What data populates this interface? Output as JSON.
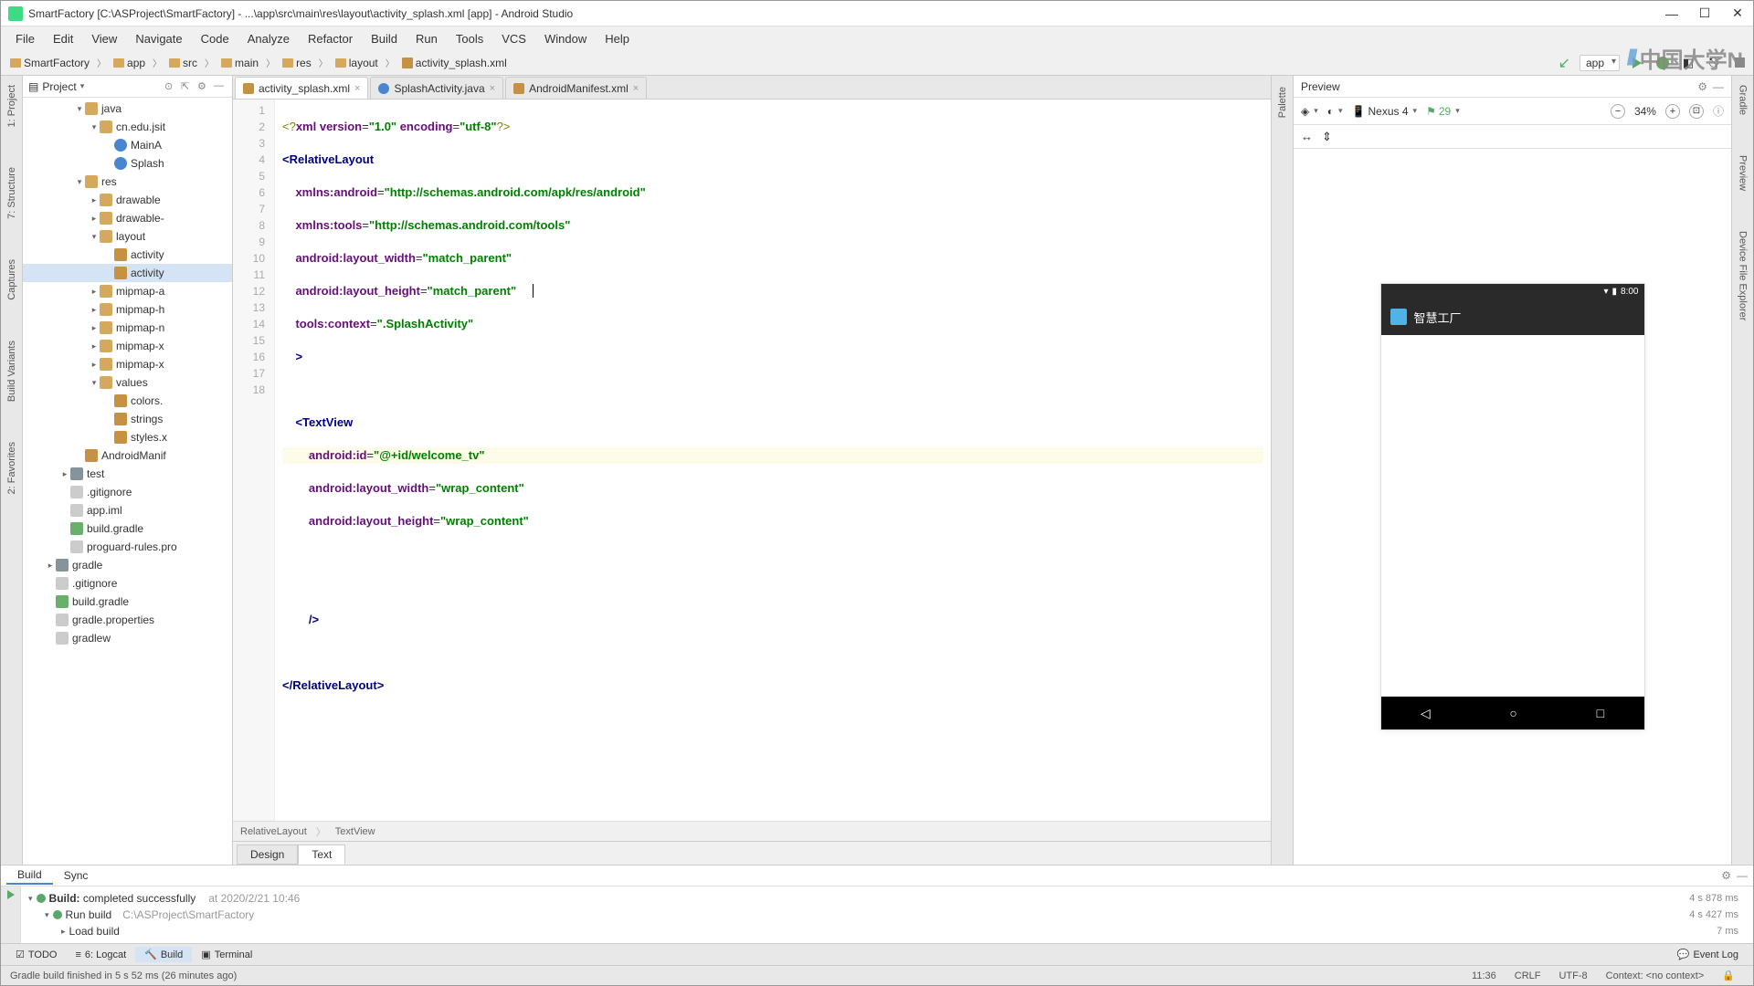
{
  "window": {
    "title": "SmartFactory [C:\\ASProject\\SmartFactory] - ...\\app\\src\\main\\res\\layout\\activity_splash.xml [app] - Android Studio"
  },
  "menu": [
    "File",
    "Edit",
    "View",
    "Navigate",
    "Code",
    "Analyze",
    "Refactor",
    "Build",
    "Run",
    "Tools",
    "VCS",
    "Window",
    "Help"
  ],
  "breadcrumb": [
    "SmartFactory",
    "app",
    "src",
    "main",
    "res",
    "layout",
    "activity_splash.xml"
  ],
  "run_config": "app",
  "watermark": "中国大学N",
  "project": {
    "header": "Project",
    "tree": [
      {
        "depth": 3,
        "exp": "▾",
        "icon": "pkg",
        "label": "java"
      },
      {
        "depth": 4,
        "exp": "▾",
        "icon": "pkg",
        "label": "cn.edu.jsit"
      },
      {
        "depth": 5,
        "exp": "",
        "icon": "java",
        "label": "MainA"
      },
      {
        "depth": 5,
        "exp": "",
        "icon": "java",
        "label": "Splash"
      },
      {
        "depth": 3,
        "exp": "▾",
        "icon": "pkg",
        "label": "res"
      },
      {
        "depth": 4,
        "exp": "▸",
        "icon": "pkg",
        "label": "drawable"
      },
      {
        "depth": 4,
        "exp": "▸",
        "icon": "pkg",
        "label": "drawable-"
      },
      {
        "depth": 4,
        "exp": "▾",
        "icon": "pkg",
        "label": "layout"
      },
      {
        "depth": 5,
        "exp": "",
        "icon": "xml",
        "label": "activity"
      },
      {
        "depth": 5,
        "exp": "",
        "icon": "xml",
        "label": "activity",
        "selected": true
      },
      {
        "depth": 4,
        "exp": "▸",
        "icon": "pkg",
        "label": "mipmap-a"
      },
      {
        "depth": 4,
        "exp": "▸",
        "icon": "pkg",
        "label": "mipmap-h"
      },
      {
        "depth": 4,
        "exp": "▸",
        "icon": "pkg",
        "label": "mipmap-n"
      },
      {
        "depth": 4,
        "exp": "▸",
        "icon": "pkg",
        "label": "mipmap-x"
      },
      {
        "depth": 4,
        "exp": "▸",
        "icon": "pkg",
        "label": "mipmap-x"
      },
      {
        "depth": 4,
        "exp": "▾",
        "icon": "pkg",
        "label": "values"
      },
      {
        "depth": 5,
        "exp": "",
        "icon": "xml",
        "label": "colors."
      },
      {
        "depth": 5,
        "exp": "",
        "icon": "xml",
        "label": "strings"
      },
      {
        "depth": 5,
        "exp": "",
        "icon": "xml",
        "label": "styles.x"
      },
      {
        "depth": 3,
        "exp": "",
        "icon": "xml",
        "label": "AndroidManif"
      },
      {
        "depth": 2,
        "exp": "▸",
        "icon": "folder",
        "label": "test"
      },
      {
        "depth": 2,
        "exp": "",
        "icon": "file",
        "label": ".gitignore"
      },
      {
        "depth": 2,
        "exp": "",
        "icon": "file",
        "label": "app.iml"
      },
      {
        "depth": 2,
        "exp": "",
        "icon": "gradle",
        "label": "build.gradle"
      },
      {
        "depth": 2,
        "exp": "",
        "icon": "file",
        "label": "proguard-rules.pro"
      },
      {
        "depth": 1,
        "exp": "▸",
        "icon": "folder",
        "label": "gradle"
      },
      {
        "depth": 1,
        "exp": "",
        "icon": "file",
        "label": ".gitignore"
      },
      {
        "depth": 1,
        "exp": "",
        "icon": "gradle",
        "label": "build.gradle"
      },
      {
        "depth": 1,
        "exp": "",
        "icon": "file",
        "label": "gradle.properties"
      },
      {
        "depth": 1,
        "exp": "",
        "icon": "file",
        "label": "gradlew"
      }
    ]
  },
  "editor": {
    "tabs": [
      {
        "icon": "xml",
        "label": "activity_splash.xml",
        "active": true
      },
      {
        "icon": "java",
        "label": "SplashActivity.java"
      },
      {
        "icon": "xml",
        "label": "AndroidManifest.xml"
      }
    ],
    "breadcrumb": [
      "RelativeLayout",
      "TextView"
    ],
    "design_text_tabs": [
      "Design",
      "Text"
    ],
    "active_dt_tab": "Text",
    "line_count": 18
  },
  "xml": {
    "l1_a": "<?",
    "l1_b": "xml version",
    "l1_c": "=",
    "l1_d": "\"1.0\"",
    "l1_e": " encoding",
    "l1_f": "=",
    "l1_g": "\"utf-8\"",
    "l1_h": "?>",
    "l2_a": "<",
    "l2_b": "RelativeLayout",
    "l3_a": "xmlns:android",
    "l3_b": "=",
    "l3_c": "\"http://schemas.android.com/apk/res/android\"",
    "l4_a": "xmlns:tools",
    "l4_b": "=",
    "l4_c": "\"http://schemas.android.com/tools\"",
    "l5_a": "android:layout_width",
    "l5_b": "=",
    "l5_c": "\"match_parent\"",
    "l6_a": "android:layout_height",
    "l6_b": "=",
    "l6_c": "\"match_parent\"",
    "l7_a": "tools:context",
    "l7_b": "=",
    "l7_c": "\".SplashActivity\"",
    "l8_a": ">",
    "l10_a": "<",
    "l10_b": "TextView",
    "l11_a": "android:id",
    "l11_b": "=",
    "l11_c": "\"@+id/welcome_tv\"",
    "l12_a": "android:layout_width",
    "l12_b": "=",
    "l12_c": "\"wrap_content\"",
    "l13_a": "android:layout_height",
    "l13_b": "=",
    "l13_c": "\"wrap_content\"",
    "l16_a": "/>",
    "l18_a": "</",
    "l18_b": "RelativeLayout",
    "l18_c": ">"
  },
  "preview": {
    "title": "Preview",
    "device": "Nexus 4",
    "api": "29",
    "zoom": "34%",
    "status_time": "8:00",
    "app_title": "智慧工厂"
  },
  "build": {
    "tabs": [
      "Build",
      "Sync"
    ],
    "row1_a": "Build: ",
    "row1_b": "completed successfully",
    "row1_time_label": "at 2020/2/21 10:46",
    "row1_dur": "4 s 878 ms",
    "row2": "Run build",
    "row2_path": "C:\\ASProject\\SmartFactory",
    "row2_dur": "4 s 427 ms",
    "row3": "Load build",
    "row3_dur": "7 ms"
  },
  "tool_windows": {
    "left": [
      "1: Project",
      "7: Structure",
      "Captures",
      "Build Variants",
      "2: Favorites"
    ],
    "right": [
      "Gradle",
      "Preview",
      "Device File Explorer"
    ],
    "bottom": [
      "TODO",
      "6: Logcat",
      "Build",
      "Terminal"
    ],
    "bottom_right": "Event Log"
  },
  "status": {
    "msg": "Gradle build finished in 5 s 52 ms (26 minutes ago)",
    "pos": "11:36",
    "line_ending": "CRLF",
    "encoding": "UTF-8",
    "context": "Context: <no context>"
  }
}
